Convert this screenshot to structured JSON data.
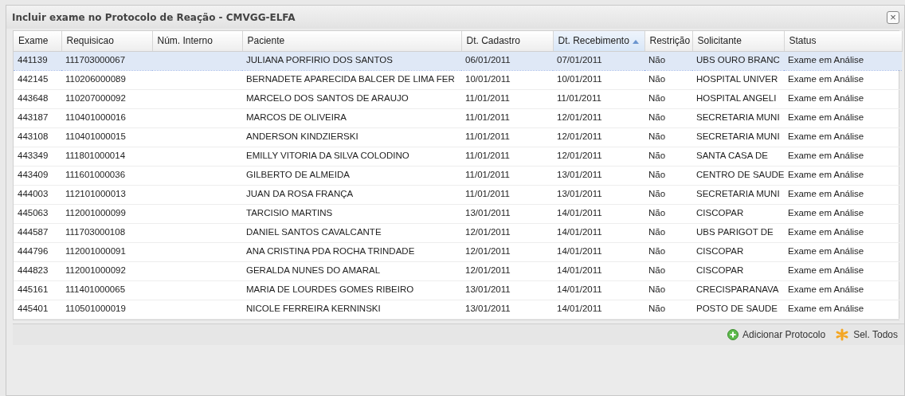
{
  "window": {
    "title": "Incluir exame no Protocolo de Reação - CMVGG-ELFA",
    "close": "×"
  },
  "table": {
    "columns": [
      {
        "label": "Exame",
        "sorted": false
      },
      {
        "label": "Requisicao",
        "sorted": false
      },
      {
        "label": "Núm. Interno",
        "sorted": false
      },
      {
        "label": "Paciente",
        "sorted": false
      },
      {
        "label": "Dt. Cadastro",
        "sorted": false
      },
      {
        "label": "Dt. Recebimento",
        "sorted": true
      },
      {
        "label": "Restrição",
        "sorted": false
      },
      {
        "label": "Solicitante",
        "sorted": false
      },
      {
        "label": "Status",
        "sorted": false
      }
    ],
    "rows": [
      {
        "selected": true,
        "cells": [
          "441139",
          "111703000067",
          "",
          "JULIANA PORFIRIO DOS SANTOS",
          "06/01/2011",
          "07/01/2011",
          "Não",
          "UBS OURO BRANC",
          "Exame em Análise"
        ]
      },
      {
        "selected": false,
        "cells": [
          "442145",
          "110206000089",
          "",
          "BERNADETE APARECIDA BALCER DE LIMA FER",
          "10/01/2011",
          "10/01/2011",
          "Não",
          "HOSPITAL UNIVER",
          "Exame em Análise"
        ]
      },
      {
        "selected": false,
        "cells": [
          "443648",
          "110207000092",
          "",
          "MARCELO DOS SANTOS DE ARAUJO",
          "11/01/2011",
          "11/01/2011",
          "Não",
          "HOSPITAL ANGELI",
          "Exame em Análise"
        ]
      },
      {
        "selected": false,
        "cells": [
          "443187",
          "110401000016",
          "",
          "MARCOS DE OLIVEIRA",
          "11/01/2011",
          "12/01/2011",
          "Não",
          "SECRETARIA MUNI",
          "Exame em Análise"
        ]
      },
      {
        "selected": false,
        "cells": [
          "443108",
          "110401000015",
          "",
          "ANDERSON KINDZIERSKI",
          "11/01/2011",
          "12/01/2011",
          "Não",
          "SECRETARIA MUNI",
          "Exame em Análise"
        ]
      },
      {
        "selected": false,
        "cells": [
          "443349",
          "111801000014",
          "",
          "EMILLY VITORIA DA SILVA COLODINO",
          "11/01/2011",
          "12/01/2011",
          "Não",
          "SANTA CASA DE",
          "Exame em Análise"
        ]
      },
      {
        "selected": false,
        "cells": [
          "443409",
          "111601000036",
          "",
          "GILBERTO DE ALMEIDA",
          "11/01/2011",
          "13/01/2011",
          "Não",
          "CENTRO DE SAUDE",
          "Exame em Análise"
        ]
      },
      {
        "selected": false,
        "cells": [
          "444003",
          "112101000013",
          "",
          "JUAN DA ROSA FRANÇA",
          "11/01/2011",
          "13/01/2011",
          "Não",
          "SECRETARIA MUNI",
          "Exame em Análise"
        ]
      },
      {
        "selected": false,
        "cells": [
          "445063",
          "112001000099",
          "",
          "TARCISIO MARTINS",
          "13/01/2011",
          "14/01/2011",
          "Não",
          "CISCOPAR",
          "Exame em Análise"
        ]
      },
      {
        "selected": false,
        "cells": [
          "444587",
          "111703000108",
          "",
          "DANIEL SANTOS CAVALCANTE",
          "12/01/2011",
          "14/01/2011",
          "Não",
          "UBS PARIGOT DE",
          "Exame em Análise"
        ]
      },
      {
        "selected": false,
        "cells": [
          "444796",
          "112001000091",
          "",
          "ANA CRISTINA PDA ROCHA TRINDADE",
          "12/01/2011",
          "14/01/2011",
          "Não",
          "CISCOPAR",
          "Exame em Análise"
        ]
      },
      {
        "selected": false,
        "cells": [
          "444823",
          "112001000092",
          "",
          "GERALDA NUNES DO AMARAL",
          "12/01/2011",
          "14/01/2011",
          "Não",
          "CISCOPAR",
          "Exame em Análise"
        ]
      },
      {
        "selected": false,
        "cells": [
          "445161",
          "111401000065",
          "",
          "MARIA DE LOURDES GOMES RIBEIRO",
          "13/01/2011",
          "14/01/2011",
          "Não",
          "CRECISPARANAVA",
          "Exame em Análise"
        ]
      },
      {
        "selected": false,
        "cells": [
          "445401",
          "110501000019",
          "",
          "NICOLE FERREIRA KERNINSKI",
          "13/01/2011",
          "14/01/2011",
          "Não",
          "POSTO DE SAUDE",
          "Exame em Análise"
        ]
      }
    ]
  },
  "toolbar": [
    {
      "kind": "add",
      "label": "Adicionar Protocolo"
    },
    {
      "kind": "select-all",
      "label": "Sel. Todos"
    }
  ]
}
